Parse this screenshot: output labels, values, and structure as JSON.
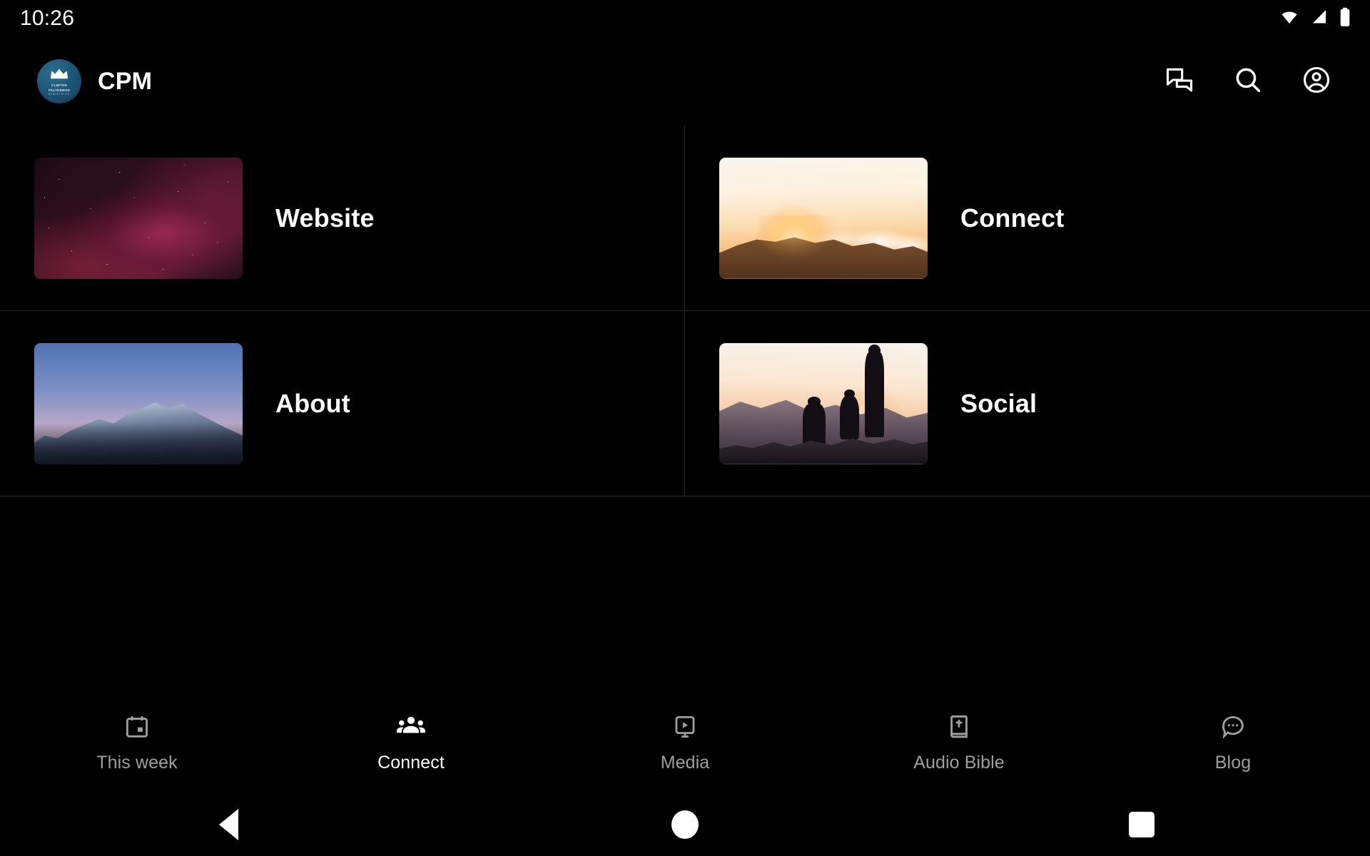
{
  "status_bar": {
    "clock": "10:26",
    "icons": [
      "wifi-icon",
      "cellular-signal-icon",
      "battery-icon"
    ]
  },
  "app_bar": {
    "logo_crown_line1": "CLINTON",
    "logo_crown_line2": "PALTERMAN",
    "logo_crown_line3": "MINISTRIES",
    "brand_name": "CPM",
    "actions": [
      {
        "name": "forum-icon",
        "label": "Forum"
      },
      {
        "name": "search-icon",
        "label": "Search"
      },
      {
        "name": "account-circle-icon",
        "label": "Account"
      }
    ]
  },
  "grid": {
    "items": [
      {
        "label": "Website",
        "art": "galaxy",
        "art_desc": "purple-red nebula star field"
      },
      {
        "label": "Connect",
        "art": "sunrise",
        "art_desc": "sunrise over mountain ridge above clouds"
      },
      {
        "label": "About",
        "art": "alpine",
        "art_desc": "snow capped mountain under blue sky"
      },
      {
        "label": "Social",
        "art": "dusk",
        "art_desc": "silhouettes of people on summit at sunset"
      }
    ]
  },
  "bottom_nav": {
    "items": [
      {
        "label": "This week",
        "icon": "calendar-icon",
        "active": false
      },
      {
        "label": "Connect",
        "icon": "groups-icon",
        "active": true
      },
      {
        "label": "Media",
        "icon": "media-play-icon",
        "active": false
      },
      {
        "label": "Audio Bible",
        "icon": "bible-book-icon",
        "active": false
      },
      {
        "label": "Blog",
        "icon": "comment-dots-icon",
        "active": false
      }
    ]
  },
  "system_nav": {
    "back": "back-triangle-icon",
    "home": "home-circle-icon",
    "recents": "recents-square-icon"
  },
  "colors": {
    "background": "#000000",
    "accent_logo": "#1d5676",
    "text_primary": "#ffffff",
    "text_muted": "#9e9e9e",
    "divider": "#2b2b2b"
  }
}
